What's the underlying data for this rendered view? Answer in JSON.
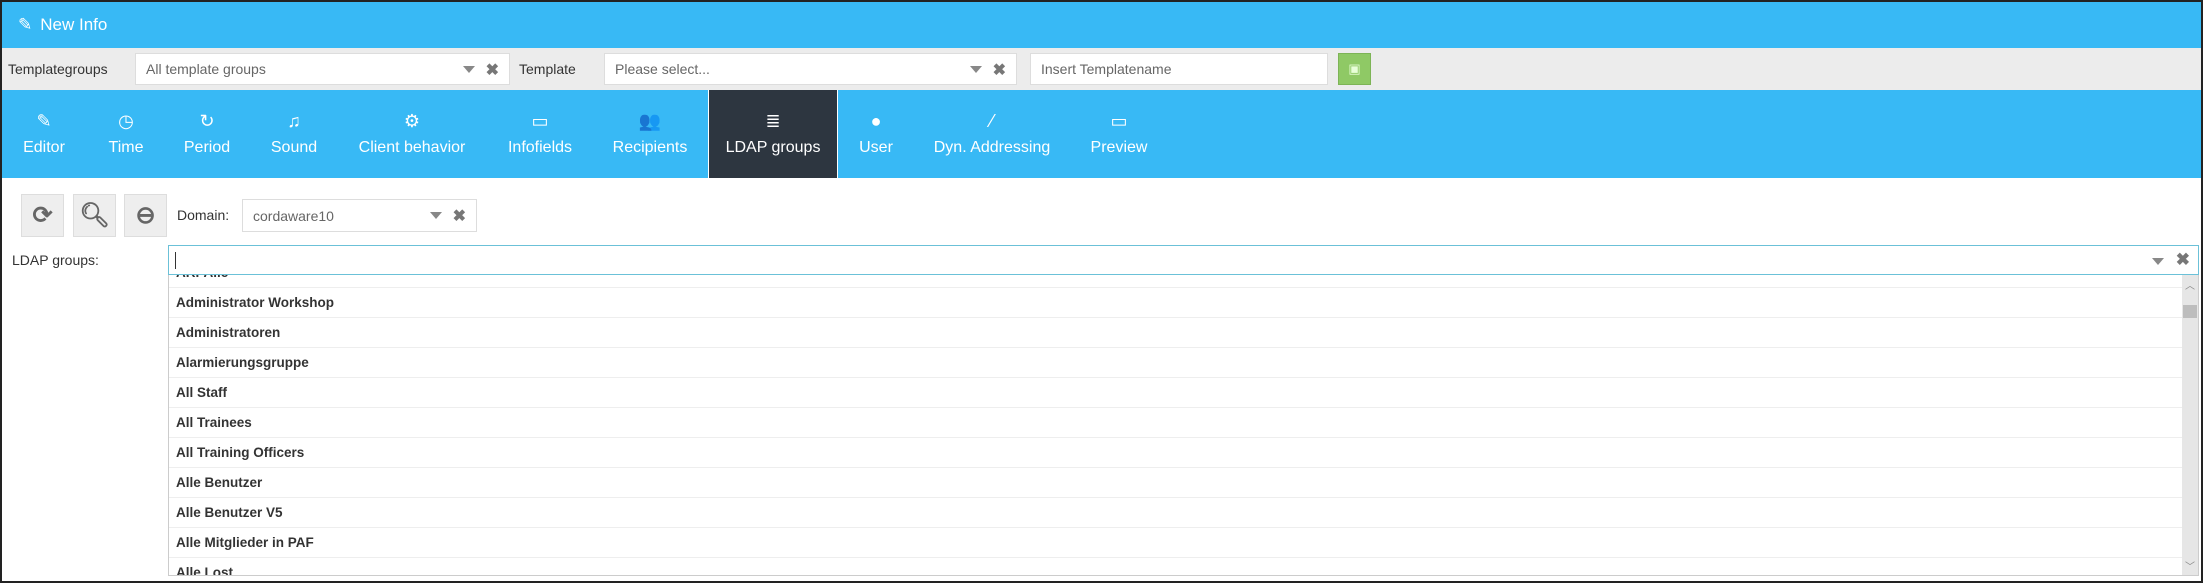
{
  "title": {
    "icon": "edit-icon",
    "text": "New Info"
  },
  "toolbar": {
    "templategroups_label": "Templategroups",
    "templategroups_value": "All template groups",
    "template_label": "Template",
    "template_placeholder": "Please select...",
    "templatename_placeholder": "Insert Templatename",
    "save_icon": "save-icon",
    "save_color": "#8fc965"
  },
  "nav": {
    "tabs": [
      {
        "label": "Editor",
        "icon": "edit-icon",
        "glyph": "✎"
      },
      {
        "label": "Time",
        "icon": "clock-icon",
        "glyph": "◷"
      },
      {
        "label": "Period",
        "icon": "refresh-icon",
        "glyph": "↻"
      },
      {
        "label": "Sound",
        "icon": "music-icon",
        "glyph": "♫"
      },
      {
        "label": "Client behavior",
        "icon": "cogs-icon",
        "glyph": "⚙"
      },
      {
        "label": "Infofields",
        "icon": "folder-icon",
        "glyph": "▭"
      },
      {
        "label": "Recipients",
        "icon": "users-icon",
        "glyph": "👥"
      },
      {
        "label": "LDAP groups",
        "icon": "database-icon",
        "glyph": "≣",
        "active": true
      },
      {
        "label": "User",
        "icon": "user-icon",
        "glyph": "●"
      },
      {
        "label": "Dyn. Addressing",
        "icon": "magic-icon",
        "glyph": "⁄"
      },
      {
        "label": "Preview",
        "icon": "desktop-icon",
        "glyph": "▭"
      }
    ],
    "color": "#38b9f5",
    "active_color": "#2d3640"
  },
  "ldap": {
    "domain_label": "Domain:",
    "domain_value": "cordaware10",
    "groups_label": "LDAP groups:",
    "search_value": "",
    "items": [
      "ARPAlle",
      "Administrator Workshop",
      "Administratoren",
      "Alarmierungsgruppe",
      "All Staff",
      "All Trainees",
      "All Training Officers",
      "Alle Benutzer",
      "Alle Benutzer V5",
      "Alle Mitglieder in PAF",
      "Alle Lost"
    ]
  }
}
